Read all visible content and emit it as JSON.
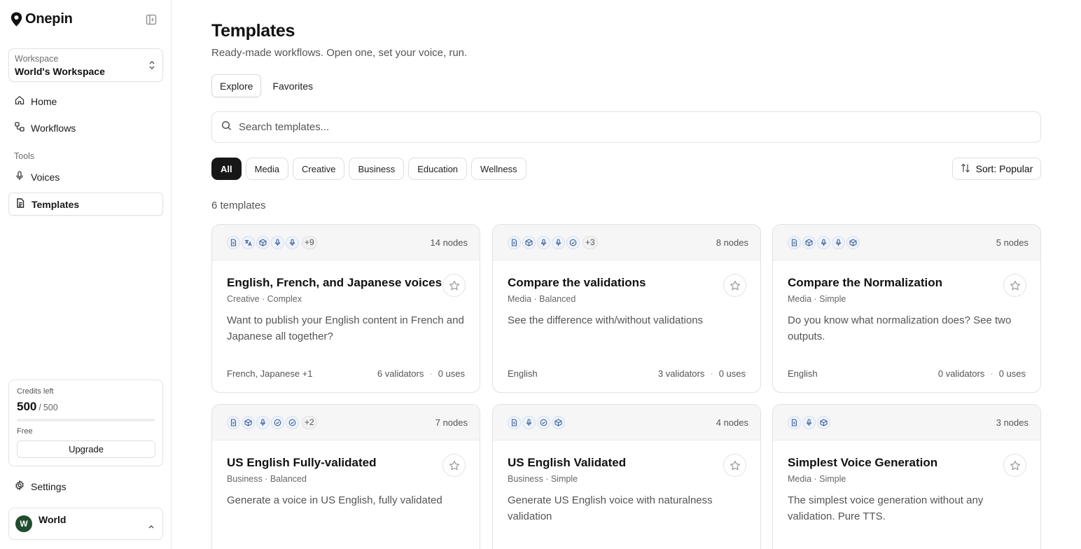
{
  "brand": {
    "name": "Onepin"
  },
  "workspace": {
    "label": "Workspace",
    "value": "World's Workspace"
  },
  "nav": {
    "home": "Home",
    "workflows": "Workflows",
    "tools_label": "Tools",
    "voices": "Voices",
    "templates": "Templates",
    "settings": "Settings"
  },
  "credits": {
    "label": "Credits left",
    "used": "500",
    "separator": "/",
    "total": "500",
    "fraction_left": 1.0,
    "plan": "Free",
    "upgrade": "Upgrade"
  },
  "user": {
    "initial": "W",
    "name": "World"
  },
  "page": {
    "title": "Templates",
    "subtitle": "Ready-made workflows. Open one, set your voice, run.",
    "tabs": [
      "Explore",
      "Favorites"
    ],
    "search_placeholder": "Search templates...",
    "filters": [
      "All",
      "Media",
      "Creative",
      "Business",
      "Education",
      "Wellness"
    ],
    "sort": "Sort: Popular",
    "count": "6 templates"
  },
  "cards": [
    {
      "icons": [
        "doc-icon",
        "translate-icon",
        "cube-icon",
        "mic-icon",
        "mic-icon"
      ],
      "more": "+9",
      "nodes": "14 nodes",
      "title": "English, French, and Japanese voices",
      "meta": "Creative · Complex",
      "desc": "Want to publish your English content in French and Japanese all together?",
      "langs": "French, Japanese +1",
      "validators": "6 validators",
      "uses": "0 uses"
    },
    {
      "icons": [
        "doc-icon",
        "cube-icon",
        "mic-icon",
        "mic-icon",
        "check-circle-icon"
      ],
      "more": "+3",
      "nodes": "8 nodes",
      "title": "Compare the validations",
      "meta": "Media · Balanced",
      "desc": "See the difference with/without validations",
      "langs": "English",
      "validators": "3 validators",
      "uses": "0 uses"
    },
    {
      "icons": [
        "doc-icon",
        "cube-icon",
        "mic-icon",
        "mic-icon",
        "cube-icon"
      ],
      "more": "",
      "nodes": "5 nodes",
      "title": "Compare the Normalization",
      "meta": "Media · Simple",
      "desc": "Do you know what normalization does? See two outputs.",
      "langs": "English",
      "validators": "0 validators",
      "uses": "0 uses"
    },
    {
      "icons": [
        "doc-icon",
        "cube-icon",
        "mic-icon",
        "check-circle-icon",
        "check-circle-icon"
      ],
      "more": "+2",
      "nodes": "7 nodes",
      "title": "US English Fully-validated",
      "meta": "Business · Balanced",
      "desc": "Generate a voice in US English, fully validated",
      "langs": "",
      "validators": "",
      "uses": ""
    },
    {
      "icons": [
        "doc-icon",
        "mic-icon",
        "check-circle-icon",
        "cube-icon"
      ],
      "more": "",
      "nodes": "4 nodes",
      "title": "US English Validated",
      "meta": "Business · Simple",
      "desc": "Generate US English voice with naturalness validation",
      "langs": "",
      "validators": "",
      "uses": ""
    },
    {
      "icons": [
        "doc-icon",
        "mic-icon",
        "cube-icon"
      ],
      "more": "",
      "nodes": "3 nodes",
      "title": "Simplest Voice Generation",
      "meta": "Media · Simple",
      "desc": "The simplest voice generation without any validation. Pure TTS.",
      "langs": "",
      "validators": "",
      "uses": ""
    }
  ]
}
